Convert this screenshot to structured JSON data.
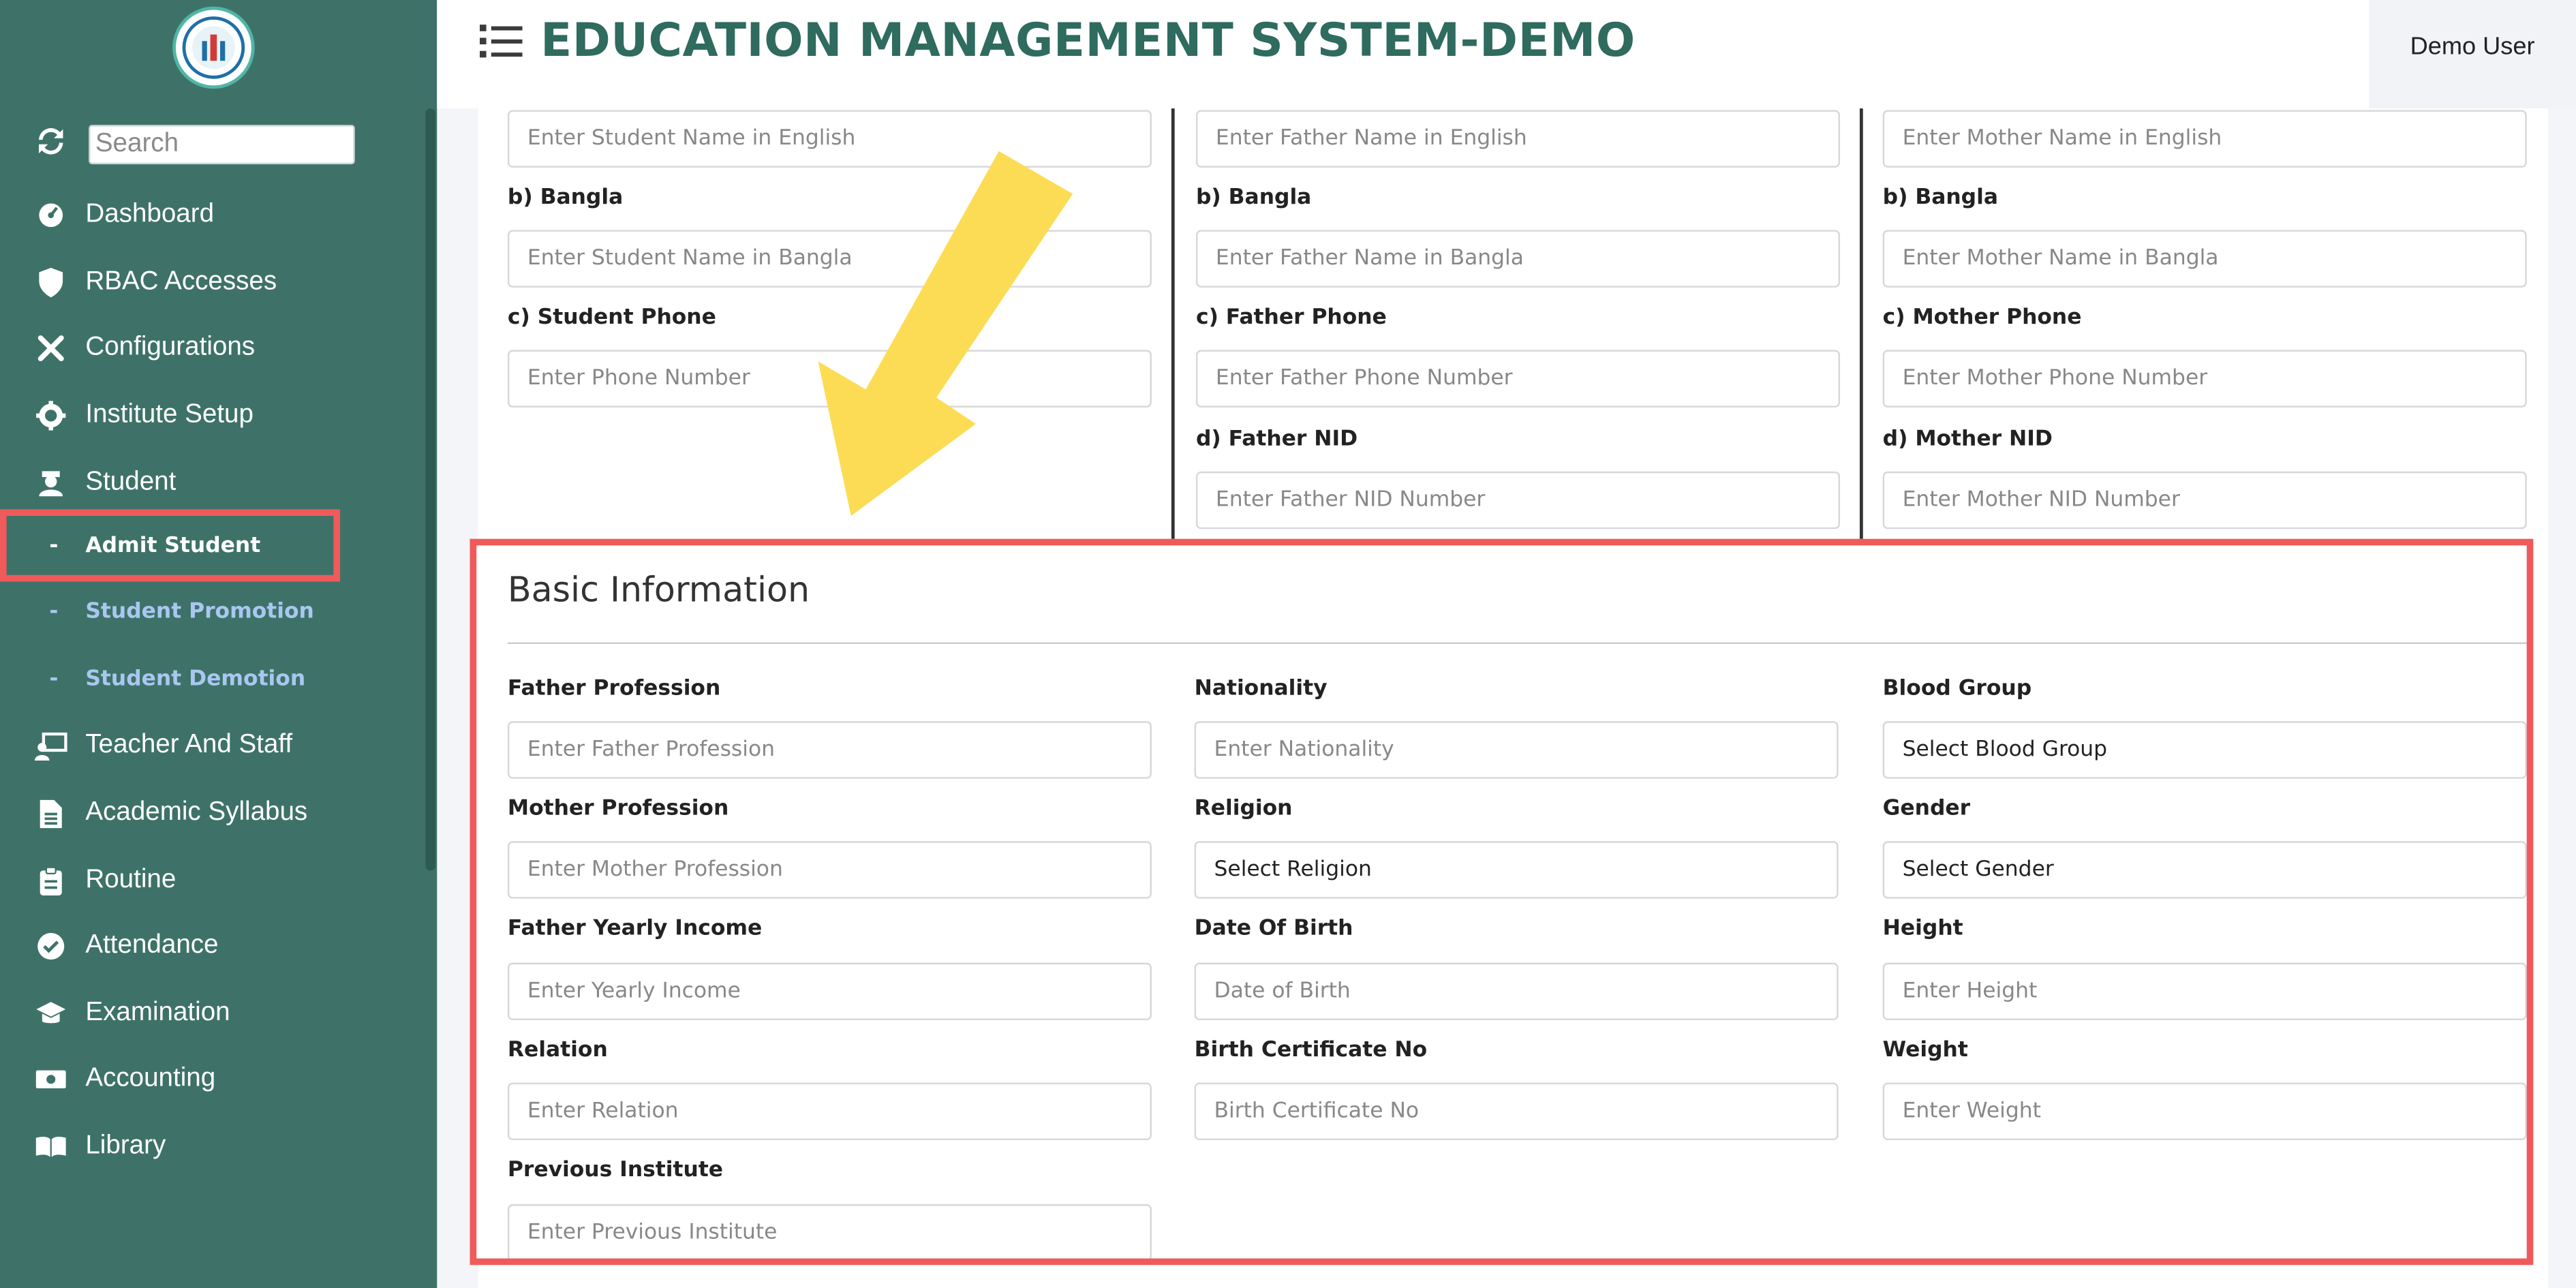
{
  "app": {
    "title": "EDUCATION MANAGEMENT SYSTEM-DEMO",
    "user": "Demo User"
  },
  "sidebar": {
    "search_placeholder": "Search",
    "items": [
      {
        "label": "Dashboard",
        "icon": "dashboard-icon"
      },
      {
        "label": "RBAC Accesses",
        "icon": "shield-icon"
      },
      {
        "label": "Configurations",
        "icon": "tools-icon"
      },
      {
        "label": "Institute Setup",
        "icon": "gear-icon"
      },
      {
        "label": "Student",
        "icon": "student-icon"
      },
      {
        "label": "Teacher And Staff",
        "icon": "teacher-icon"
      },
      {
        "label": "Academic Syllabus",
        "icon": "document-icon"
      },
      {
        "label": "Routine",
        "icon": "clipboard-icon"
      },
      {
        "label": "Attendance",
        "icon": "check-circle-icon"
      },
      {
        "label": "Examination",
        "icon": "graduation-cap-icon"
      },
      {
        "label": "Accounting",
        "icon": "money-icon"
      },
      {
        "label": "Library",
        "icon": "book-icon"
      }
    ],
    "student_sub": [
      {
        "label": "Admit Student"
      },
      {
        "label": "Student Promotion"
      },
      {
        "label": "Student Demotion"
      }
    ]
  },
  "top_section": {
    "student": {
      "name_en_placeholder": "Enter Student Name in English",
      "bangla_label": "b) Bangla",
      "name_bn_placeholder": "Enter Student Name in Bangla",
      "phone_label": "c) Student Phone",
      "phone_placeholder": "Enter Phone Number"
    },
    "father": {
      "name_en_placeholder": "Enter Father Name in English",
      "bangla_label": "b) Bangla",
      "name_bn_placeholder": "Enter Father Name in Bangla",
      "phone_label": "c) Father Phone",
      "phone_placeholder": "Enter Father Phone Number",
      "nid_label": "d) Father NID",
      "nid_placeholder": "Enter Father NID Number"
    },
    "mother": {
      "name_en_placeholder": "Enter Mother Name in English",
      "bangla_label": "b) Bangla",
      "name_bn_placeholder": "Enter Mother Name in Bangla",
      "phone_label": "c) Mother Phone",
      "phone_placeholder": "Enter Mother Phone Number",
      "nid_label": "d) Mother NID",
      "nid_placeholder": "Enter Mother NID Number"
    }
  },
  "basic_info": {
    "title": "Basic Information",
    "father_profession": {
      "label": "Father Profession",
      "placeholder": "Enter Father Profession"
    },
    "nationality": {
      "label": "Nationality",
      "placeholder": "Enter Nationality"
    },
    "blood_group": {
      "label": "Blood Group",
      "value": "Select Blood Group"
    },
    "mother_profession": {
      "label": "Mother Profession",
      "placeholder": "Enter Mother Profession"
    },
    "religion": {
      "label": "Religion",
      "value": "Select Religion"
    },
    "gender": {
      "label": "Gender",
      "value": "Select Gender"
    },
    "yearly_income": {
      "label": "Father Yearly Income",
      "placeholder": "Enter Yearly Income"
    },
    "dob": {
      "label": "Date Of Birth",
      "placeholder": "Date of Birth"
    },
    "height": {
      "label": "Height",
      "placeholder": "Enter Height"
    },
    "relation": {
      "label": "Relation",
      "placeholder": "Enter Relation"
    },
    "birth_cert": {
      "label": "Birth Certificate No",
      "placeholder": "Birth Certificate No"
    },
    "weight": {
      "label": "Weight",
      "placeholder": "Enter Weight"
    },
    "previous_institute": {
      "label": "Previous Institute",
      "placeholder": "Enter Previous Institute"
    }
  },
  "colors": {
    "sidebar_bg": "#3e7268",
    "title_color": "#2f6b5f",
    "highlight": "#f05a5a",
    "arrow": "#fcdc55"
  }
}
